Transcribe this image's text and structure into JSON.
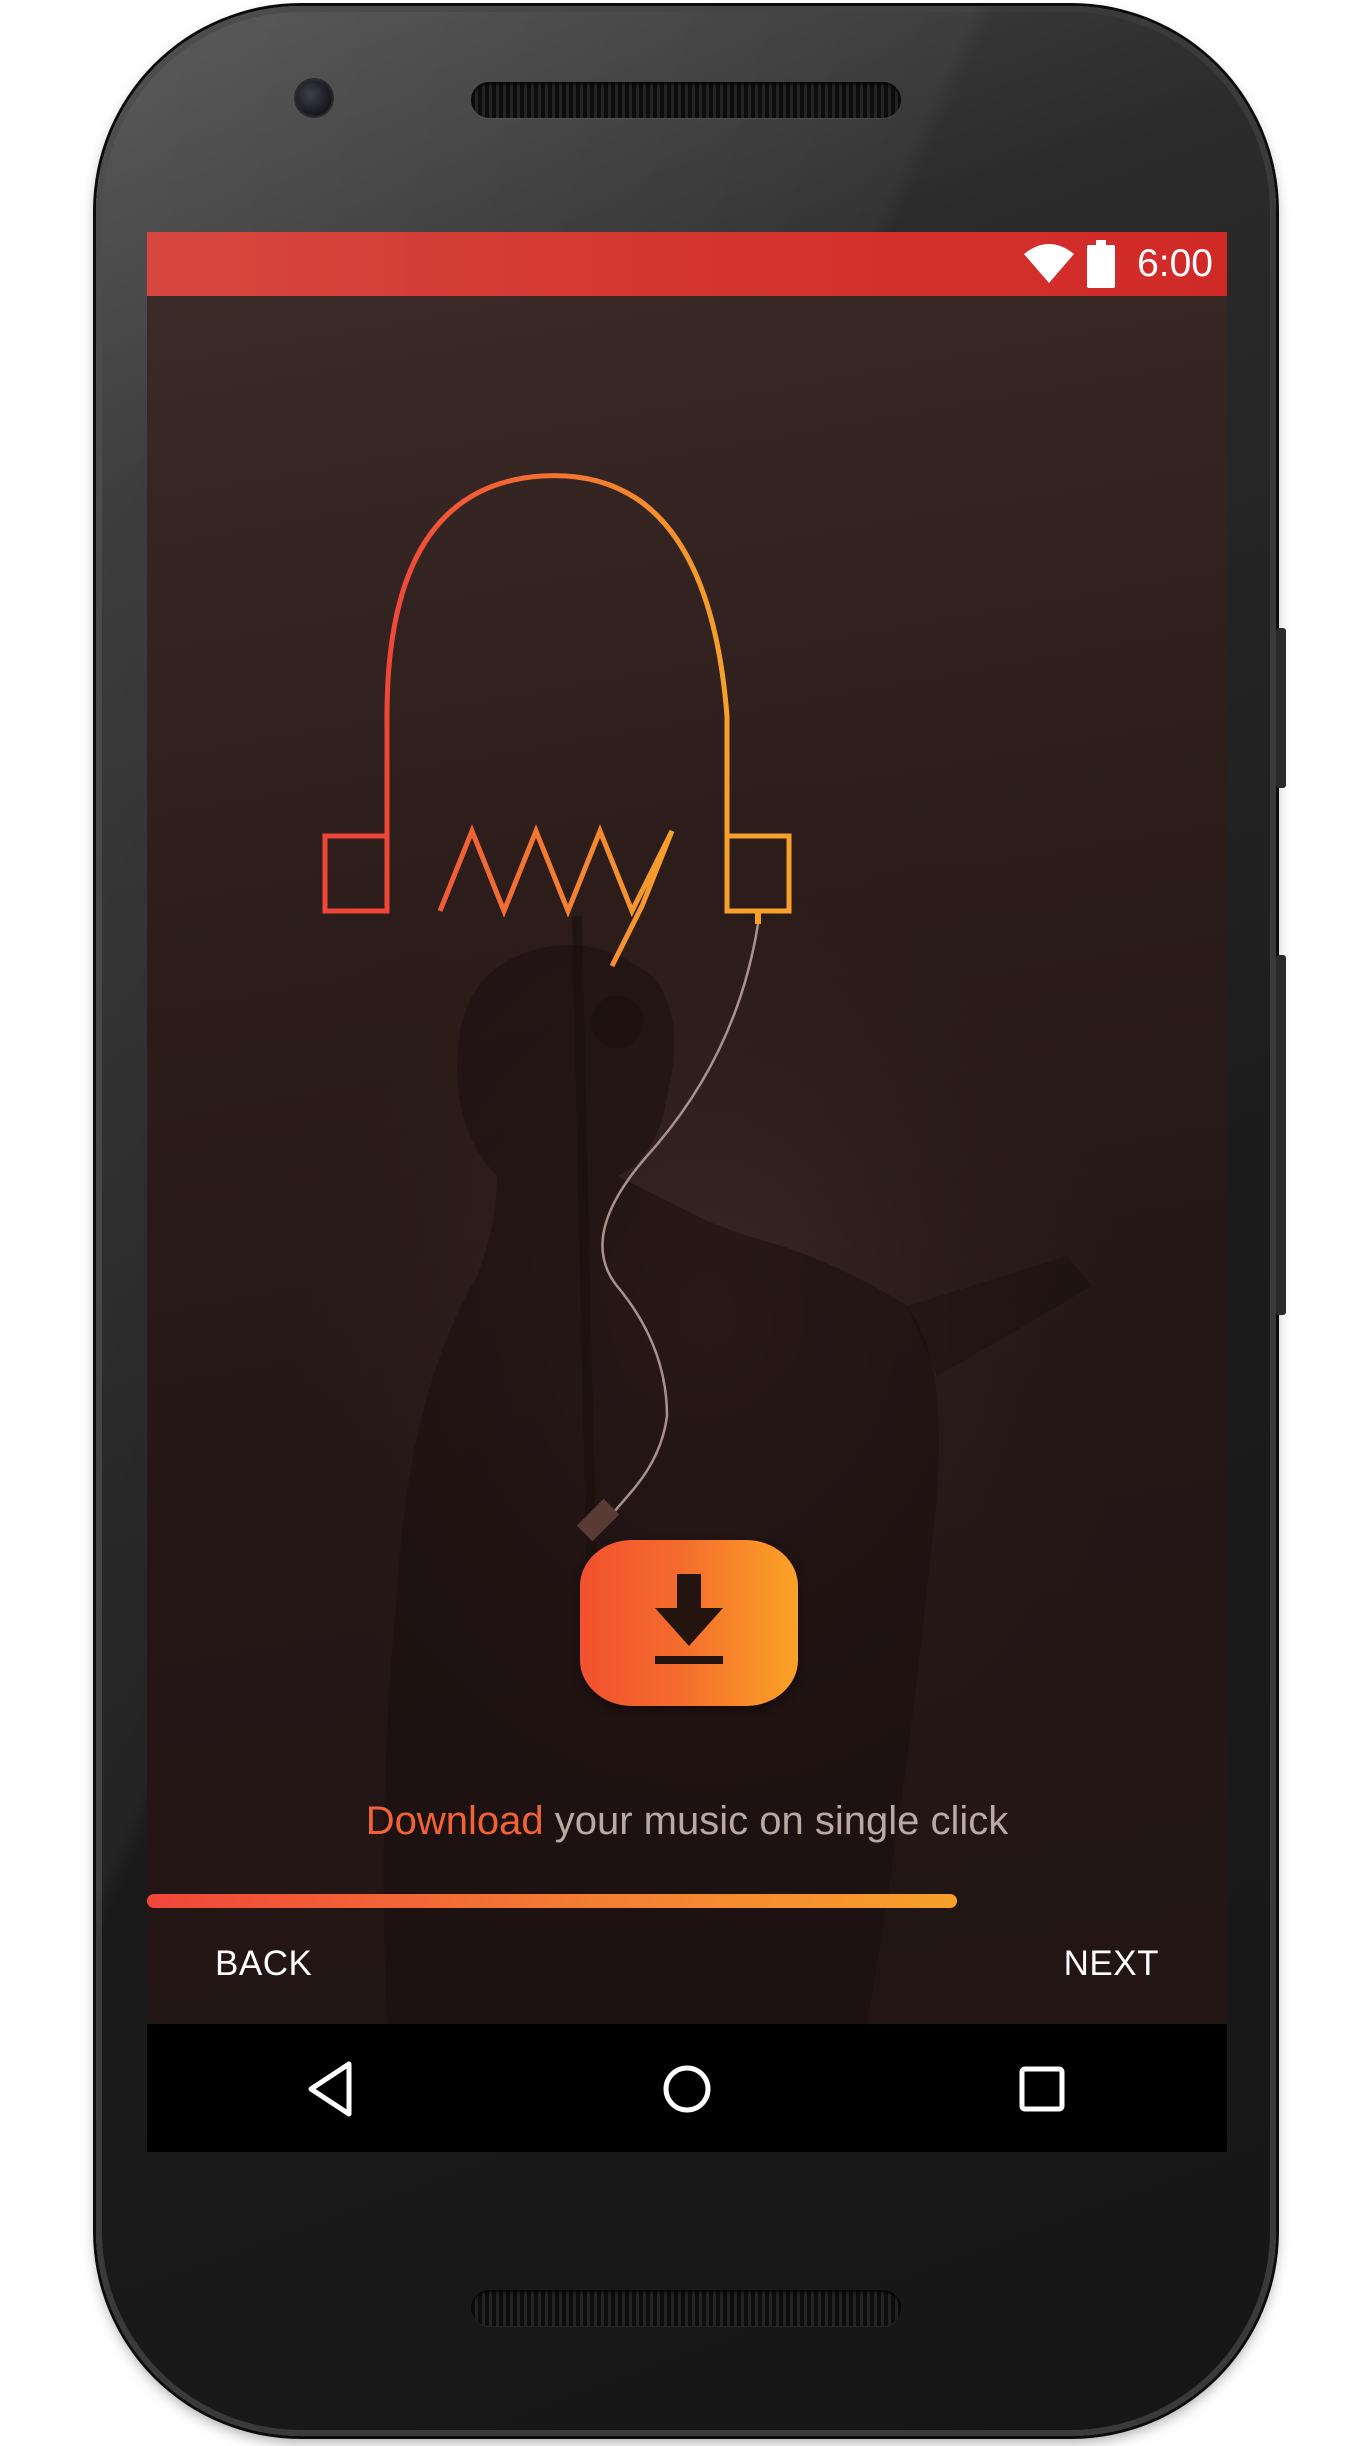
{
  "status_bar": {
    "time": "6:00",
    "icons": [
      "wifi-icon",
      "battery-icon"
    ],
    "background": "#d4322e"
  },
  "onboarding": {
    "logo": "headphones-logo",
    "brand_mark": "Amy",
    "action_icon": "download-icon",
    "caption_highlight": "Download",
    "caption_rest": " your music on single click",
    "progress": 0.75,
    "back_label": "BACK",
    "next_label": "NEXT"
  },
  "system_nav": {
    "icons": [
      "back-triangle-icon",
      "home-circle-icon",
      "recents-square-icon"
    ]
  },
  "colors": {
    "accent_orange": "#f47e32",
    "accent_red": "#f0463a",
    "accent_yellow": "#fba227",
    "caption_text": "#b9a8a4"
  }
}
